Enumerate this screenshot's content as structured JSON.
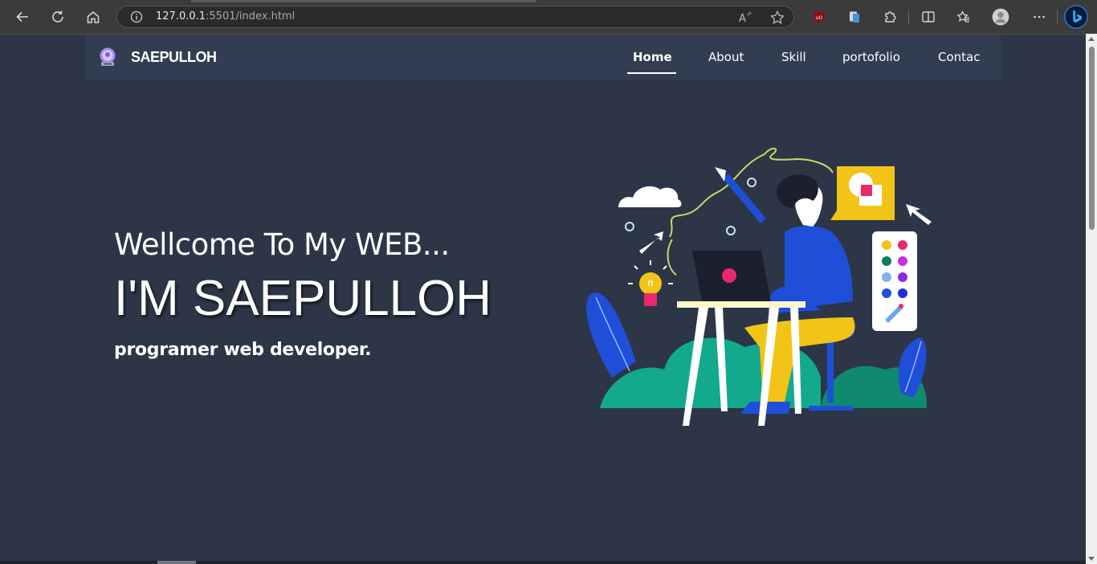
{
  "browser": {
    "url_host": "127.0.0.1",
    "url_rest": ":5501/index.html"
  },
  "navbar": {
    "brand": "SAEPULLOH",
    "links": [
      {
        "label": "Home",
        "active": true
      },
      {
        "label": "About"
      },
      {
        "label": "Skill"
      },
      {
        "label": "portofolio"
      },
      {
        "label": "Contac"
      }
    ]
  },
  "hero": {
    "greeting": "Wellcome To My WEB...",
    "name": "I'M SAEPULLOH",
    "role": "programer web developer."
  },
  "colors": {
    "page_bg": "#2c3646",
    "navbar_bg": "#323d51",
    "accent_yellow": "#f2c418",
    "accent_blue": "#1f4fd8",
    "accent_teal": "#12a98c",
    "accent_pink": "#e8296b"
  },
  "icons": [
    "back-icon",
    "refresh-icon",
    "home-icon",
    "info-icon",
    "read-aloud-icon",
    "favorite-star-icon",
    "ublock-icon",
    "extension-clipboard-icon",
    "extensions-icon",
    "split-screen-icon",
    "favorites-icon",
    "profile-icon",
    "more-icon",
    "bing-icon",
    "logo-icon"
  ]
}
